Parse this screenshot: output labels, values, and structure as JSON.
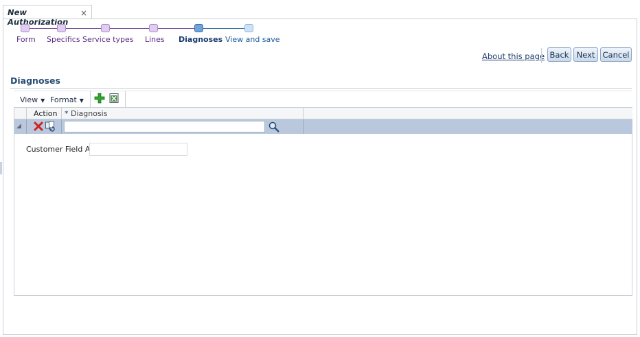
{
  "tab": {
    "title": "New Authorization",
    "close_glyph": "×"
  },
  "train": {
    "stops": [
      {
        "label": "Form",
        "state": "visited"
      },
      {
        "label": "Specifics",
        "state": "visited"
      },
      {
        "label": "Service types",
        "state": "visited"
      },
      {
        "label": "Lines",
        "state": "visited"
      },
      {
        "label": "Diagnoses",
        "state": "current"
      },
      {
        "label": "View and save",
        "state": "next"
      }
    ]
  },
  "actions": {
    "about": "About this page",
    "back": "Back",
    "next": "Next",
    "cancel": "Cancel"
  },
  "section": {
    "title": "Diagnoses"
  },
  "toolbar": {
    "view": "View",
    "format": "Format",
    "add_icon": "add-row-icon",
    "export_icon": "export-excel-icon"
  },
  "grid": {
    "columns": {
      "action": "Action",
      "required_marker": "*",
      "diagnosis": "Diagnosis"
    },
    "row": {
      "diagnosis_value": "",
      "delete_icon": "delete-icon",
      "duplicate_icon": "duplicate-icon",
      "search_icon": "search-icon"
    }
  },
  "customer_field": {
    "label": "Customer Field A",
    "value": ""
  },
  "colors": {
    "accent": "#284d73",
    "row_selected": "#b9c8dd",
    "train_visited": "#5b2f84"
  }
}
